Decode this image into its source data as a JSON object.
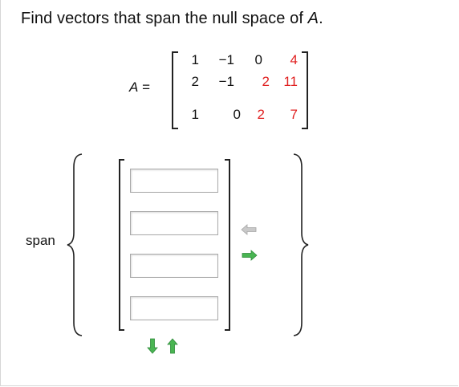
{
  "question": {
    "prefix": "Find vectors that span the null space of ",
    "matrix_name": "A",
    "suffix": "."
  },
  "matrix": {
    "label_var": "A",
    "label_eq": " =",
    "rows": [
      [
        {
          "v": "1",
          "red": false
        },
        {
          "v": "−1",
          "red": false
        },
        {
          "v": "0",
          "red": false
        },
        {
          "v": "4",
          "red": true
        }
      ],
      [
        {
          "v": "2",
          "red": false
        },
        {
          "v": "−1",
          "red": false
        },
        {
          "v": "2",
          "red": true
        },
        {
          "v": "11",
          "red": true
        }
      ],
      [
        {
          "v": "1",
          "red": false
        },
        {
          "v": "0",
          "red": false
        },
        {
          "v": "2",
          "red": true
        },
        {
          "v": "7",
          "red": true
        }
      ]
    ]
  },
  "span": {
    "label": "span",
    "inputs": [
      {
        "value": "",
        "placeholder": ""
      },
      {
        "value": "",
        "placeholder": ""
      },
      {
        "value": "",
        "placeholder": ""
      },
      {
        "value": "",
        "placeholder": ""
      }
    ]
  },
  "icons": {
    "remove_vector": "arrow-left-icon",
    "add_vector": "arrow-right-icon",
    "remove_row": "arrow-down-icon",
    "add_row": "arrow-up-icon"
  },
  "colors": {
    "red_entry": "#e02020",
    "arrow_active": "#3aa24a",
    "arrow_disabled": "#bdbdbd"
  }
}
